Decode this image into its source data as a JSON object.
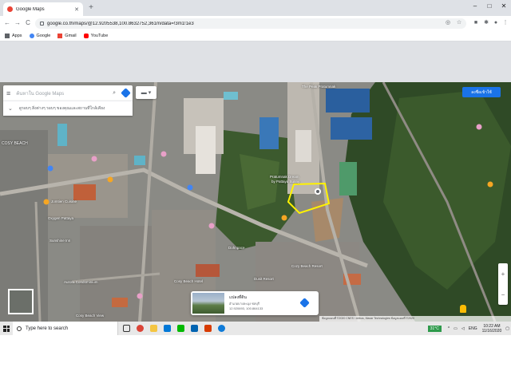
{
  "browser": {
    "tab": {
      "title": "Google Maps"
    },
    "new_tab": "+",
    "window_controls": {
      "minimize": "–",
      "maximize": "□",
      "close": "✕"
    },
    "nav": {
      "back": "←",
      "forward": "→",
      "reload": "C"
    },
    "url": "google.co.th/maps/@12.9205538,100.8632752,361m/data=!3m1!1e3",
    "bookmarks": [
      {
        "label": "Apps",
        "icon": "apps-grid-icon",
        "color": "#5f6368"
      },
      {
        "label": "Google",
        "icon": "google-icon",
        "color": "#4285f4"
      },
      {
        "label": "Gmail",
        "icon": "gmail-icon",
        "color": "#ea4335"
      },
      {
        "label": "YouTube",
        "icon": "youtube-icon",
        "color": "#ff0000"
      }
    ]
  },
  "maps": {
    "search_placeholder": "ค้นหาใน Google Maps",
    "explore_text": "ดูรอบๆ สิ่งต่างๆ รอบๆ ของคุณและสถานที่ใกล้เคียง",
    "sign_in": "ลงชื่อเข้าใช้",
    "zoom_in": "+",
    "zoom_out": "−",
    "labels": [
      {
        "text": "The Peak Pratumnak",
        "color": "#ffffff"
      },
      {
        "text": "Pratumnak Dream",
        "color": "#ffffff"
      },
      {
        "text": "by Pattaya Sunny",
        "color": "#ffffff"
      },
      {
        "text": "COSY BEACH",
        "color": "#ffffff"
      },
      {
        "text": "Jomtien Cuisine",
        "color": "#ffffff"
      },
      {
        "text": "Oxygen Pattaya",
        "color": "#ffffff"
      },
      {
        "text": "Sunshine Inn",
        "color": "#ffffff"
      },
      {
        "text": "Aurora Condominium",
        "color": "#ffffff"
      },
      {
        "text": "Cosy Beach View",
        "color": "#ffffff"
      },
      {
        "text": "Dohnpace",
        "color": "#ffffff"
      },
      {
        "text": "Cosy Beach Hotel",
        "color": "#ffffff"
      },
      {
        "text": "Cozy Beach Resort",
        "color": "#ffffff"
      },
      {
        "text": "Dusit Resort",
        "color": "#ffffff"
      }
    ],
    "info_card": {
      "title": "แปลงที่ดิน",
      "address": "อำเภอบางละมุง ชลบุรี",
      "coords": "12.920693, 100.864133"
    },
    "attribution": "ข้อมูลแผนที่ ©2020 CNES / Airbus, Maxar Technologies ข้อมูลแผนที่ ©2020"
  },
  "taskbar": {
    "search_placeholder": "Type here to search",
    "apps": [
      {
        "icon": "task-view-icon",
        "color": "#333333"
      },
      {
        "icon": "chrome-icon",
        "color": "#db4437"
      },
      {
        "icon": "file-explorer-icon",
        "color": "#f4c542"
      },
      {
        "icon": "store-icon",
        "color": "#0078d7"
      },
      {
        "icon": "line-icon",
        "color": "#00b900"
      },
      {
        "icon": "mail-icon",
        "color": "#0063b1"
      },
      {
        "icon": "office-icon",
        "color": "#d83b01"
      },
      {
        "icon": "edge-icon",
        "color": "#0f7bd8"
      }
    ],
    "temp": "31°C",
    "lang": "ENG",
    "time": "10:22 AM",
    "date": "11/16/2020"
  }
}
